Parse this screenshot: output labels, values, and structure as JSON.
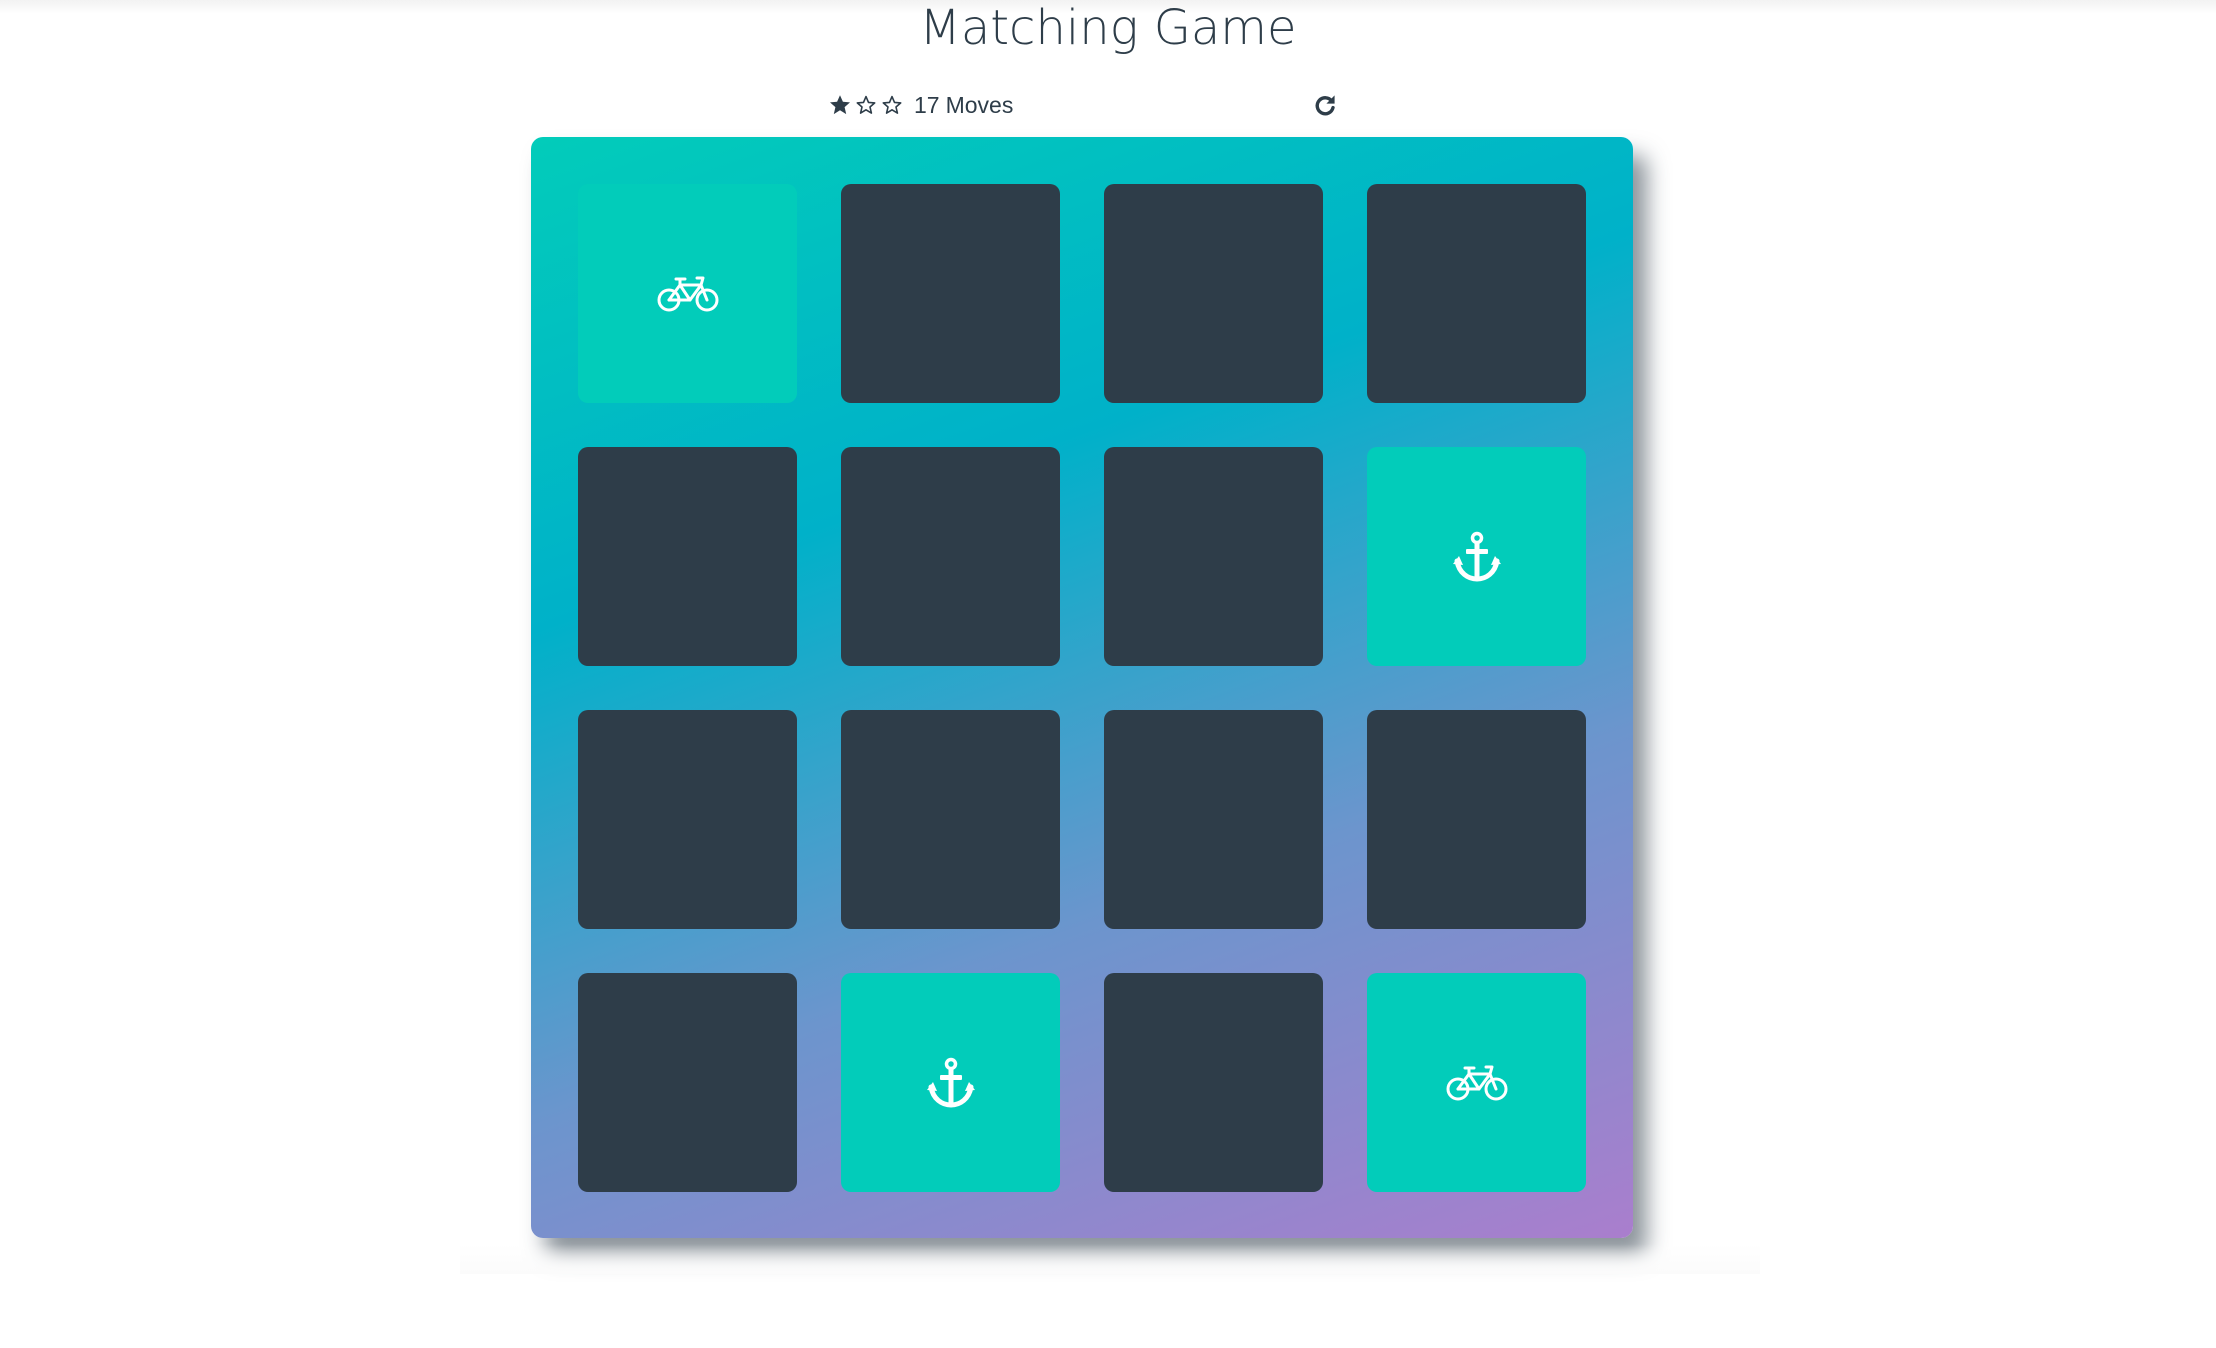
{
  "header": {
    "title": "Matching Game"
  },
  "score_panel": {
    "stars": [
      {
        "state": "filled",
        "icon": "star-filled-icon"
      },
      {
        "state": "empty",
        "icon": "star-outline-icon"
      },
      {
        "state": "empty",
        "icon": "star-outline-icon"
      }
    ],
    "moves_count": "17",
    "moves_label": "Moves",
    "restart_icon": "repeat-icon"
  },
  "colors": {
    "card_back": "#2e3d49",
    "card_open": "#02ccba",
    "text": "#2e3d49",
    "deck_gradient_start": "#02ccba",
    "deck_gradient_mid": "#00b1c9",
    "deck_gradient_end": "#aa7ecd"
  },
  "deck": {
    "rows": 4,
    "columns": 4,
    "cards": [
      {
        "state": "open",
        "icon": "bicycle-icon"
      },
      {
        "state": "closed",
        "icon": ""
      },
      {
        "state": "closed",
        "icon": ""
      },
      {
        "state": "closed",
        "icon": ""
      },
      {
        "state": "closed",
        "icon": ""
      },
      {
        "state": "closed",
        "icon": ""
      },
      {
        "state": "closed",
        "icon": ""
      },
      {
        "state": "open",
        "icon": "anchor-icon"
      },
      {
        "state": "closed",
        "icon": ""
      },
      {
        "state": "closed",
        "icon": ""
      },
      {
        "state": "closed",
        "icon": ""
      },
      {
        "state": "closed",
        "icon": ""
      },
      {
        "state": "closed",
        "icon": ""
      },
      {
        "state": "open",
        "icon": "anchor-icon"
      },
      {
        "state": "closed",
        "icon": ""
      },
      {
        "state": "open",
        "icon": "bicycle-icon"
      }
    ]
  }
}
